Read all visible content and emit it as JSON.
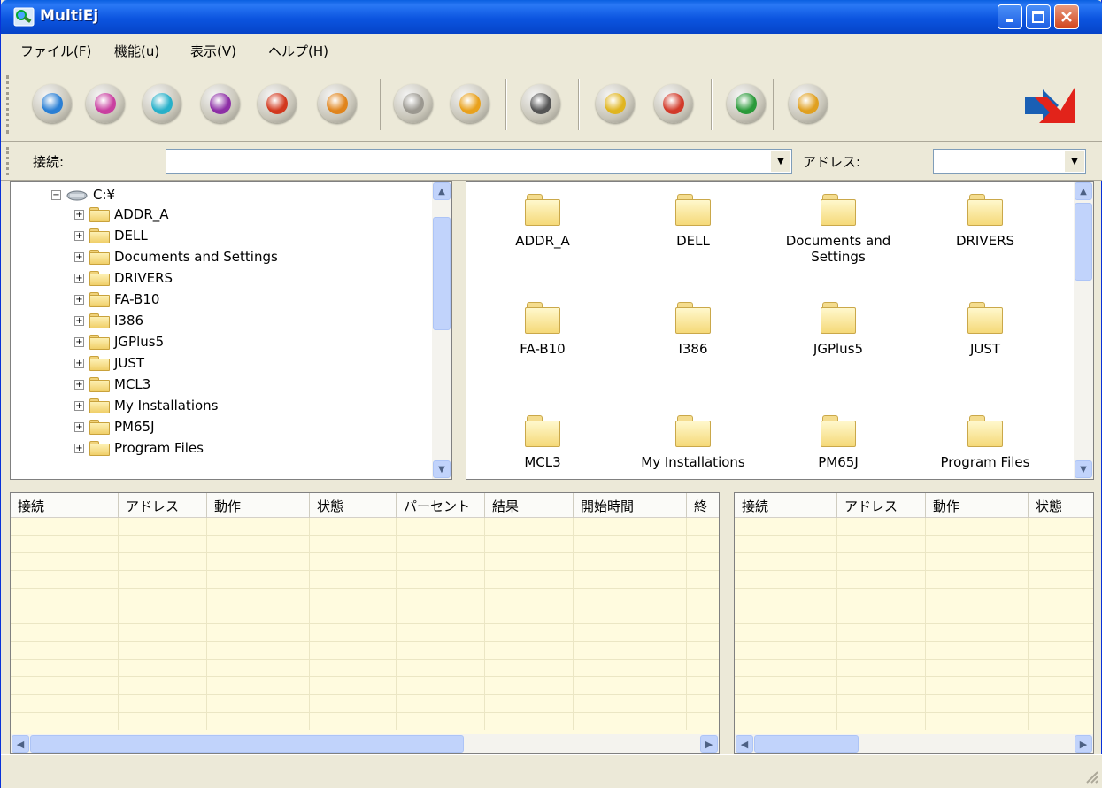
{
  "window": {
    "title": "MultiEj"
  },
  "menu": [
    "ファイル(F)",
    "機能(u)",
    "表示(V)",
    "ヘルプ(H)"
  ],
  "toolbar": {
    "tools": [
      {
        "icon": "connect-icon",
        "color": "#2a7fd4"
      },
      {
        "icon": "disconnect-icon",
        "color": "#c93fa0"
      },
      {
        "icon": "send-icon",
        "color": "#27b0c9"
      },
      {
        "icon": "receive-icon",
        "color": "#8d2fa6"
      },
      {
        "icon": "transfer-icon",
        "color": "#d2381e"
      },
      {
        "icon": "swap-arrows-icon",
        "color": "#e0841c"
      },
      {
        "icon": "delete-icon",
        "color": "#9b9890"
      },
      {
        "icon": "edit-icon",
        "color": "#e9a11c"
      },
      {
        "icon": "timer-icon",
        "color": "#555555"
      },
      {
        "icon": "download-warning-icon",
        "color": "#e0b520"
      },
      {
        "icon": "upload-warning-icon",
        "color": "#d23a2a"
      },
      {
        "icon": "calculator-icon",
        "color": "#2a9a3a"
      },
      {
        "icon": "home-icon",
        "color": "#e0a020"
      }
    ]
  },
  "addressbar": {
    "connect_label": "接続:",
    "connect_value": "",
    "address_label": "アドレス:",
    "address_value": ""
  },
  "tree": {
    "root": "C:¥",
    "items": [
      "ADDR_A",
      "DELL",
      "Documents and Settings",
      "DRIVERS",
      "FA-B10",
      "I386",
      "JGPlus5",
      "JUST",
      "MCL3",
      "My Installations",
      "PM65J",
      "Program Files"
    ]
  },
  "icons": [
    [
      "ADDR_A"
    ],
    [
      "DELL"
    ],
    [
      "Documents and",
      "Settings"
    ],
    [
      "DRIVERS"
    ],
    [
      "FA-B10"
    ],
    [
      "I386"
    ],
    [
      "JGPlus5"
    ],
    [
      "JUST"
    ],
    [
      "MCL3"
    ],
    [
      "My Installations"
    ],
    [
      "PM65J"
    ],
    [
      "Program Files"
    ]
  ],
  "list_left": {
    "columns": [
      "接続",
      "アドレス",
      "動作",
      "状態",
      "パーセント",
      "結果",
      "開始時間",
      "終"
    ]
  },
  "list_right": {
    "columns": [
      "接続",
      "アドレス",
      "動作",
      "状態"
    ]
  },
  "colors": {
    "titlebar": "#0a5fe0",
    "list_bg": "#fffbdf",
    "logo_red": "#e2231a",
    "logo_blue": "#1a5fb4"
  }
}
